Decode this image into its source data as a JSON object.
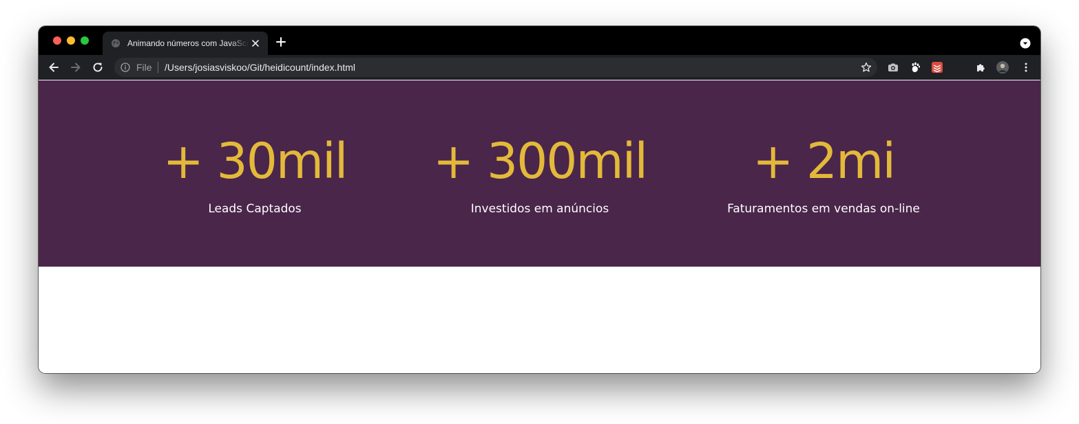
{
  "browser": {
    "tab": {
      "title": "Animando números com JavaScript",
      "favicon": "globe-icon"
    },
    "address_bar": {
      "scheme_label": "File",
      "url": "/Users/josiasviskoo/Git/heidicount/index.html"
    },
    "extensions": [
      "camera-icon",
      "gnome-paw-icon",
      "todoist-icon",
      "puzzle-extensions-icon",
      "profile-avatar-icon",
      "more-menu-icon"
    ]
  },
  "page": {
    "colors": {
      "hero_background": "#4a264b",
      "stat_value": "#e3b93a",
      "stat_label": "#ffffff"
    },
    "stats": [
      {
        "value": "+ 30mil",
        "label": "Leads Captados"
      },
      {
        "value": "+ 300mil",
        "label": "Investidos em anúncios"
      },
      {
        "value": "+ 2mi",
        "label": "Faturamentos em vendas on-line"
      }
    ]
  }
}
